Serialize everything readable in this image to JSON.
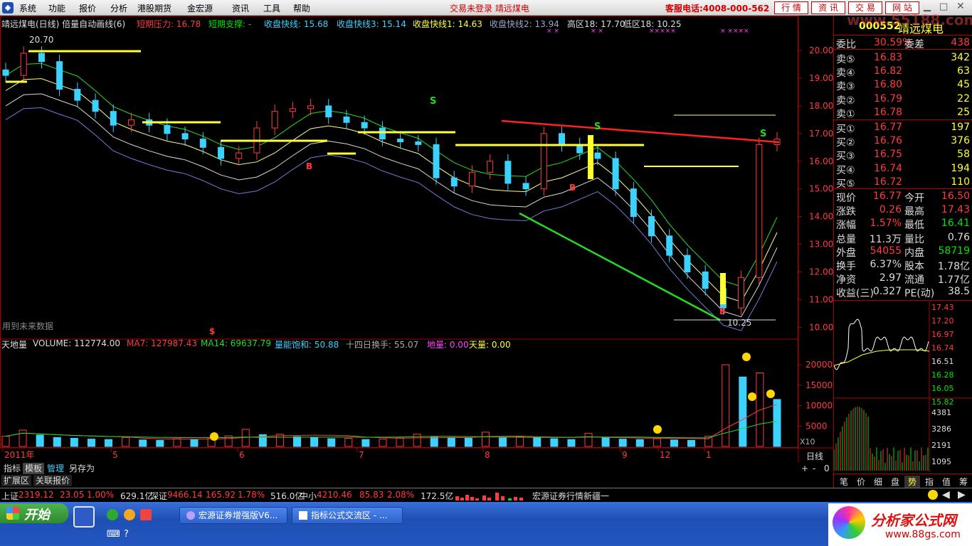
{
  "menubar": {
    "items": [
      "系统",
      "功能",
      "报价",
      "分析",
      "港股期货",
      "金宏源",
      "资讯",
      "工具",
      "帮助"
    ],
    "login_status": "交易未登录  靖远煤电",
    "hotline": "客服电话:4008-000-562",
    "buttons": [
      "行 情",
      "资 讯",
      "交 易",
      "网 站"
    ]
  },
  "chart_header": {
    "title": "靖远煤电(日线) 倍量自动画线(6)",
    "ind1": "短期压力: 16.78",
    "ind2": "短期支撑: -",
    "ind3": "收盘快线: 15.68",
    "ind4": "收盘快线3: 15.14",
    "ind5": "收盘快线1: 14.63",
    "ind6": "收盘快线2: 13.94",
    "ind7": "高区18: 17.70",
    "ind8": "低区18: 10.25"
  },
  "price_axis": [
    "20.00",
    "19.00",
    "18.00",
    "17.00",
    "16.00",
    "15.00",
    "14.00",
    "13.00",
    "12.00",
    "11.00",
    "10.00"
  ],
  "price_annotations": {
    "high": "20.70",
    "low": "10.25",
    "future_note": "用到未来数据"
  },
  "volume_header": {
    "name": "天地量",
    "volume": "VOLUME: 112774.00",
    "ma7": "MA7: 127987.43",
    "ma14": "MA14: 69637.79",
    "saturation": "量能饱和: 50.88",
    "turnover14": "十四日换手: 55.07",
    "ground": "地量: 0.00",
    "sky": "天量: 0.00"
  },
  "volume_axis": [
    "20000",
    "15000",
    "10000",
    "5000"
  ],
  "volume_unit": "X10",
  "date_axis": [
    "2011年",
    "5",
    "6",
    "7",
    "8",
    "9",
    "12",
    "1"
  ],
  "period": "日线",
  "bottom_tabs": [
    "指标",
    "模板",
    "管理",
    "另存为"
  ],
  "bottom_tabs2": [
    "扩展区",
    "关联报价"
  ],
  "zoom": [
    "+",
    "-",
    "0"
  ],
  "quote": {
    "code": "000552",
    "name": "靖远煤电",
    "wb_label": "委比",
    "wb": "30.59%",
    "wc_label": "委差",
    "wc": "438",
    "asks": [
      {
        "label": "卖⑤",
        "price": "16.83",
        "vol": "342"
      },
      {
        "label": "卖④",
        "price": "16.82",
        "vol": "63"
      },
      {
        "label": "卖③",
        "price": "16.80",
        "vol": "45"
      },
      {
        "label": "卖②",
        "price": "16.79",
        "vol": "22"
      },
      {
        "label": "卖①",
        "price": "16.78",
        "vol": "25"
      }
    ],
    "bids": [
      {
        "label": "买①",
        "price": "16.77",
        "vol": "197"
      },
      {
        "label": "买②",
        "price": "16.76",
        "vol": "376"
      },
      {
        "label": "买③",
        "price": "16.75",
        "vol": "58"
      },
      {
        "label": "买④",
        "price": "16.74",
        "vol": "194"
      },
      {
        "label": "买⑤",
        "price": "16.72",
        "vol": "110"
      }
    ],
    "stats": [
      {
        "l1": "现价",
        "v1": "16.77",
        "l2": "今开",
        "v2": "16.50"
      },
      {
        "l1": "涨跌",
        "v1": "0.26",
        "l2": "最高",
        "v2": "17.43"
      },
      {
        "l1": "涨幅",
        "v1": "1.57%",
        "l2": "最低",
        "v2": "16.41"
      },
      {
        "l1": "总量",
        "v1": "11.3万",
        "l2": "量比",
        "v2": "0.76"
      },
      {
        "l1": "外盘",
        "v1": "54055",
        "l2": "内盘",
        "v2": "58719"
      },
      {
        "l1": "换手",
        "v1": "6.37%",
        "l2": "股本",
        "v2": "1.78亿"
      },
      {
        "l1": "净资",
        "v1": "2.97",
        "l2": "流通",
        "v2": "1.77亿"
      },
      {
        "l1": "收益(三)",
        "v1": "0.327",
        "l2": "PE(动)",
        "v2": "38.5"
      }
    ],
    "mini_axis": [
      "17.43",
      "17.20",
      "16.97",
      "16.74",
      "16.51",
      "16.28",
      "16.05",
      "15.82"
    ],
    "mini_vol_axis": [
      "4381",
      "3286",
      "2191",
      "1095"
    ],
    "tabs": [
      "笔",
      "价",
      "细",
      "盘",
      "势",
      "指",
      "值",
      "筹"
    ]
  },
  "index_bar": {
    "sh": {
      "name": "上证",
      "val": "2319.12",
      "chg": "23.05",
      "pct": "1.00%",
      "amt": "629.1亿"
    },
    "sz": {
      "name": "深证",
      "val": "9466.14",
      "chg": "165.92",
      "pct": "1.78%",
      "amt": "516.0亿"
    },
    "zx": {
      "name": "中小",
      "val": "4210.46",
      "chg": "85.83",
      "pct": "2.08%",
      "amt": "172.5亿"
    },
    "news": "宏源证券行情新疆一"
  },
  "taskbar": {
    "start": "开始",
    "tasks": [
      "宏源证券增强版V6...",
      "指标公式交流区 - ..."
    ],
    "watermark1": "分析家公式网",
    "watermark2": "www.88gs.com",
    "site_watermark": "www.55188.com"
  },
  "colors": {
    "up": "#ff3c3c",
    "down": "#00e600",
    "cyan": "#3cd2ff",
    "yellow": "#ffff33"
  },
  "chart_data": [
    {
      "type": "candlestick",
      "title": "靖远煤电(日线)",
      "ylim": [
        9.7,
        20.9
      ],
      "x": [
        "2011年",
        "5",
        "6",
        "7",
        "8",
        "9",
        "12",
        "1"
      ],
      "close_approx": [
        19.1,
        19.9,
        19.6,
        18.6,
        18.2,
        17.8,
        17.3,
        17.5,
        17.3,
        17.0,
        16.8,
        16.5,
        16.1,
        16.3,
        17.2,
        17.8,
        17.9,
        18.0,
        17.6,
        17.4,
        17.2,
        16.8,
        16.7,
        16.6,
        15.4,
        15.1,
        15.6,
        16.0,
        15.2,
        15.0,
        17.0,
        16.6,
        16.3,
        16.1,
        15.0,
        14.0,
        13.3,
        12.6,
        12.0,
        11.4,
        10.7,
        11.8,
        16.6,
        16.8
      ],
      "overlays": {
        "high_mark": 20.7,
        "low_mark": 10.25,
        "high_zone": 17.7,
        "low_zone": 10.25
      }
    },
    {
      "type": "bar",
      "title": "天地量",
      "ylim": [
        0,
        24000
      ],
      "values_approx": [
        2500,
        4000,
        2800,
        2200,
        2000,
        1800,
        1700,
        2200,
        1600,
        1500,
        1900,
        1700,
        2100,
        2600,
        4200,
        2900,
        3000,
        2400,
        2200,
        1900,
        2000,
        1700,
        1800,
        2100,
        3000,
        2400,
        2200,
        2000,
        3500,
        2100,
        2400,
        2100,
        1900,
        1700,
        3200,
        2100,
        1800,
        1700,
        1900,
        1600,
        1500,
        2500,
        20000,
        17000,
        18000,
        11500
      ]
    }
  ]
}
